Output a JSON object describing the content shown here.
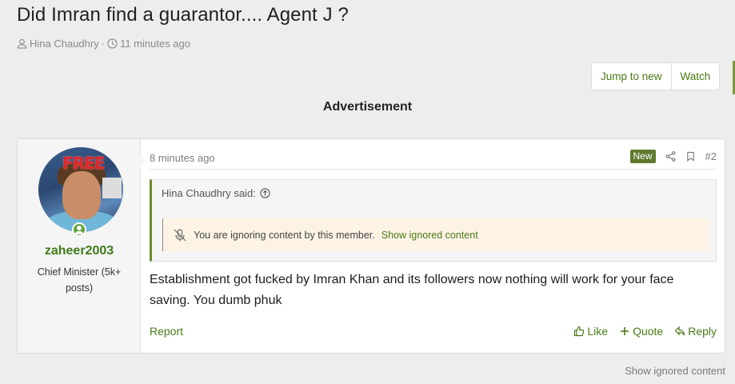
{
  "thread": {
    "title": "Did Imran find a guarantor.... Agent J ?",
    "author": "Hina Chaudhry",
    "separator": "·",
    "time": "11 minutes ago"
  },
  "toolbar": {
    "jump_label": "Jump to new",
    "watch_label": "Watch"
  },
  "advert_label": "Advertisement",
  "post": {
    "user": {
      "avatar_text": "FREE",
      "username": "zaheer2003",
      "title": "Chief Minister (5k+ posts)"
    },
    "date": "8 minutes ago",
    "badge": "New",
    "number": "#2",
    "quote": {
      "author_said": "Hina Chaudhry said:",
      "ignored_text": "You are ignoring content by this member.",
      "ignored_link": "Show ignored content"
    },
    "body": "Establishment got fucked by Imran Khan and its followers now nothing will work for your face saving. You dumb phuk",
    "report_label": "Report",
    "like_label": "Like",
    "quote_label": "Quote",
    "reply_label": "Reply"
  },
  "footer": {
    "show_ignored": "Show ignored content"
  },
  "colors": {
    "accent": "#4a7a17",
    "badge_new": "#5f7a2f",
    "quote_border": "#6b8b2f"
  }
}
